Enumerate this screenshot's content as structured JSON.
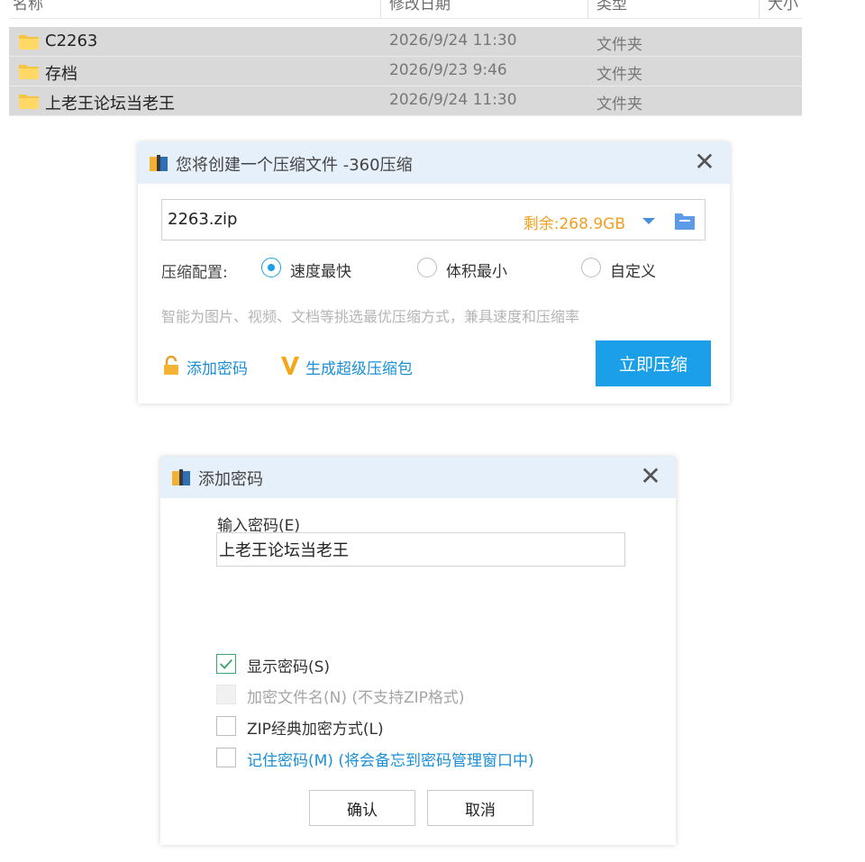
{
  "explorer": {
    "columns": [
      "名称",
      "修改日期",
      "类型",
      "大小"
    ],
    "rows": [
      {
        "name": "C2263",
        "date": "2026/9/24 11:30",
        "type": "文件夹"
      },
      {
        "name": "存档",
        "date": "2026/9/23 9:46",
        "type": "文件夹"
      },
      {
        "name": "上老王论坛当老王",
        "date": "2026/9/24 11:30",
        "type": "文件夹"
      }
    ]
  },
  "compress_dialog": {
    "title": "您将创建一个压缩文件 -360压缩",
    "filename": "2263.zip",
    "remaining": "剩余:268.9GB",
    "config_label": "压缩配置:",
    "options": [
      "速度最快",
      "体积最小",
      "自定义"
    ],
    "selected_option": "速度最快",
    "hint": "智能为图片、视频、文档等挑选最优压缩方式，兼具速度和压缩率",
    "add_password": "添加密码",
    "super_package": "生成超级压缩包",
    "compress_button": "立即压缩"
  },
  "password_dialog": {
    "title": "添加密码",
    "input_label": "输入密码(E)",
    "password_value": "上老王论坛当老王",
    "show_password": {
      "label": "显示密码(S)",
      "checked": true
    },
    "encrypt_filenames": {
      "label": "加密文件名(N) (不支持ZIP格式)",
      "checked": false,
      "disabled": true
    },
    "zip_classic": {
      "label": "ZIP经典加密方式(L)",
      "checked": false
    },
    "remember_password": {
      "label": "记住密码(M) (将会备忘到密码管理窗口中)",
      "checked": false
    },
    "ok_button": "确认",
    "cancel_button": "取消"
  },
  "colors": {
    "accent": "#1a9fe8",
    "remaining": "#f0a020",
    "link": "#1a8fd8",
    "titlebar": "#e6f0fa",
    "row_selected": "#d9d9d9",
    "check": "#39a86d"
  }
}
